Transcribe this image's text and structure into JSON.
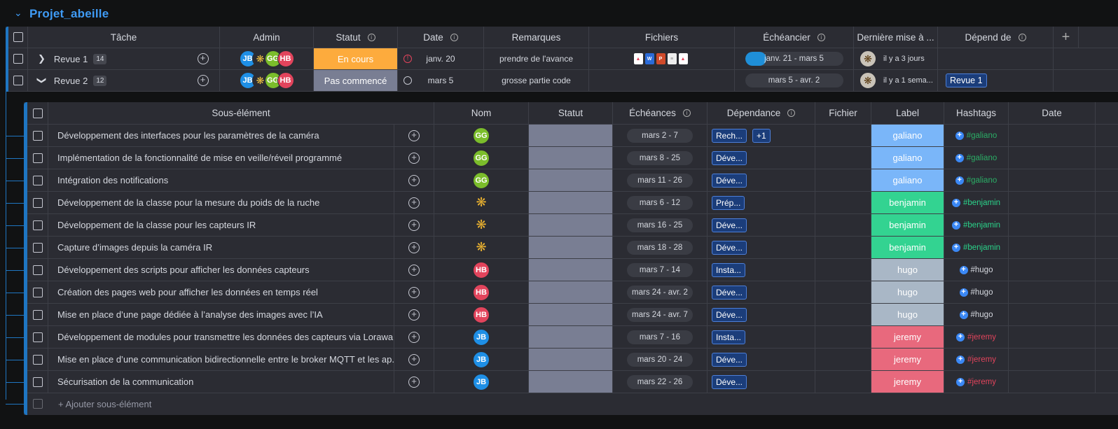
{
  "group": {
    "title": "Projet_abeille",
    "accent": "#3f9bf5"
  },
  "main_headers": {
    "task": "Tâche",
    "admin": "Admin",
    "status": "Statut",
    "date": "Date",
    "remarks": "Remarques",
    "files": "Fichiers",
    "timeline": "Échéancier",
    "last_update": "Dernière mise à ...",
    "depends": "Dépend de",
    "add": "+"
  },
  "main_rows": [
    {
      "name": "Revue 1",
      "count": "14",
      "status": "En cours",
      "status_color": "#fdab3d",
      "date": "janv. 20",
      "remarks": "prendre de l'avance",
      "timeline": "janv. 21 - mars 5",
      "last_update": "il y a 3 jours",
      "depends": ""
    },
    {
      "name": "Revue 2",
      "count": "12",
      "status": "Pas commencé",
      "status_color": "#797e93",
      "date": "mars 5",
      "remarks": "grosse partie code",
      "timeline": "mars 5 - avr. 2",
      "last_update": "il y a 1 sema...",
      "depends": "Revue 1"
    }
  ],
  "sub_headers": {
    "item": "Sous-élément",
    "name": "Nom",
    "status": "Statut",
    "deadlines": "Échéances",
    "dependency": "Dépendance",
    "file": "Fichier",
    "label": "Label",
    "hashtags": "Hashtags",
    "date": "Date"
  },
  "sub_rows": [
    {
      "title": "Développement des interfaces pour les paramètres de la caméra",
      "owner": "GG",
      "owner_type": "gg",
      "deadline": "mars 2 - 7",
      "dep": "Rech...",
      "dep_extra": "+1",
      "label": "galiano",
      "hashtag": "#galiano"
    },
    {
      "title": "Implémentation de la fonctionnalité de mise en veille/réveil programmé",
      "owner": "GG",
      "owner_type": "gg",
      "deadline": "mars 8 - 25",
      "dep": "Déve...",
      "dep_extra": "",
      "label": "galiano",
      "hashtag": "#galiano"
    },
    {
      "title": "Intégration des notifications",
      "owner": "GG",
      "owner_type": "gg",
      "deadline": "mars 11 - 26",
      "dep": "Déve...",
      "dep_extra": "",
      "label": "galiano",
      "hashtag": "#galiano"
    },
    {
      "title": "Développement de la classe pour la mesure du poids de la ruche",
      "owner": "",
      "owner_type": "bee",
      "deadline": "mars 6 - 12",
      "dep": "Prép...",
      "dep_extra": "",
      "label": "benjamin",
      "hashtag": "#benjamin"
    },
    {
      "title": "Développement de la classe pour les capteurs IR",
      "owner": "",
      "owner_type": "bee",
      "deadline": "mars 16 - 25",
      "dep": "Déve...",
      "dep_extra": "",
      "label": "benjamin",
      "hashtag": "#benjamin"
    },
    {
      "title": "Capture d’images depuis la caméra IR",
      "owner": "",
      "owner_type": "bee",
      "deadline": "mars 18 - 28",
      "dep": "Déve...",
      "dep_extra": "",
      "label": "benjamin",
      "hashtag": "#benjamin"
    },
    {
      "title": "Développement des scripts pour afficher les données capteurs",
      "owner": "HB",
      "owner_type": "hb",
      "deadline": "mars 7 - 14",
      "dep": "Insta...",
      "dep_extra": "",
      "label": "hugo",
      "hashtag": "#hugo"
    },
    {
      "title": "Création des pages web pour afficher les données en temps réel",
      "owner": "HB",
      "owner_type": "hb",
      "deadline": "mars 24 - avr. 2",
      "dep": "Déve...",
      "dep_extra": "",
      "label": "hugo",
      "hashtag": "#hugo"
    },
    {
      "title": "Mise en place d’une page dédiée à l’analyse des images avec l’IA",
      "owner": "HB",
      "owner_type": "hb",
      "deadline": "mars 24 - avr. 7",
      "dep": "Déve...",
      "dep_extra": "",
      "label": "hugo",
      "hashtag": "#hugo"
    },
    {
      "title": "Développement de modules pour transmettre les données des capteurs via Lorawan",
      "owner": "JB",
      "owner_type": "jb",
      "deadline": "mars 7 - 16",
      "dep": "Insta...",
      "dep_extra": "",
      "label": "jeremy",
      "hashtag": "#jeremy"
    },
    {
      "title": "Mise en place d’une communication bidirectionnelle entre le broker MQTT et les ap...",
      "owner": "JB",
      "owner_type": "jb",
      "deadline": "mars 20 - 24",
      "dep": "Déve...",
      "dep_extra": "",
      "label": "jeremy",
      "hashtag": "#jeremy"
    },
    {
      "title": "Sécurisation de la communication",
      "owner": "JB",
      "owner_type": "jb",
      "deadline": "mars 22 - 26",
      "dep": "Déve...",
      "dep_extra": "",
      "label": "jeremy",
      "hashtag": "#jeremy"
    }
  ],
  "label_colors": {
    "galiano": "#7ab6f9",
    "benjamin": "#33d391",
    "hugo": "#a9b7c6",
    "jeremy": "#e8697d"
  },
  "hashtag_colors": {
    "galiano": "#2bae66",
    "benjamin": "#2bd38a",
    "hugo": "#d5d8df",
    "jeremy": "#e2445c"
  },
  "add_subitem": "+ Ajouter sous-élément",
  "admins": [
    "JB",
    "GG",
    "HB"
  ]
}
